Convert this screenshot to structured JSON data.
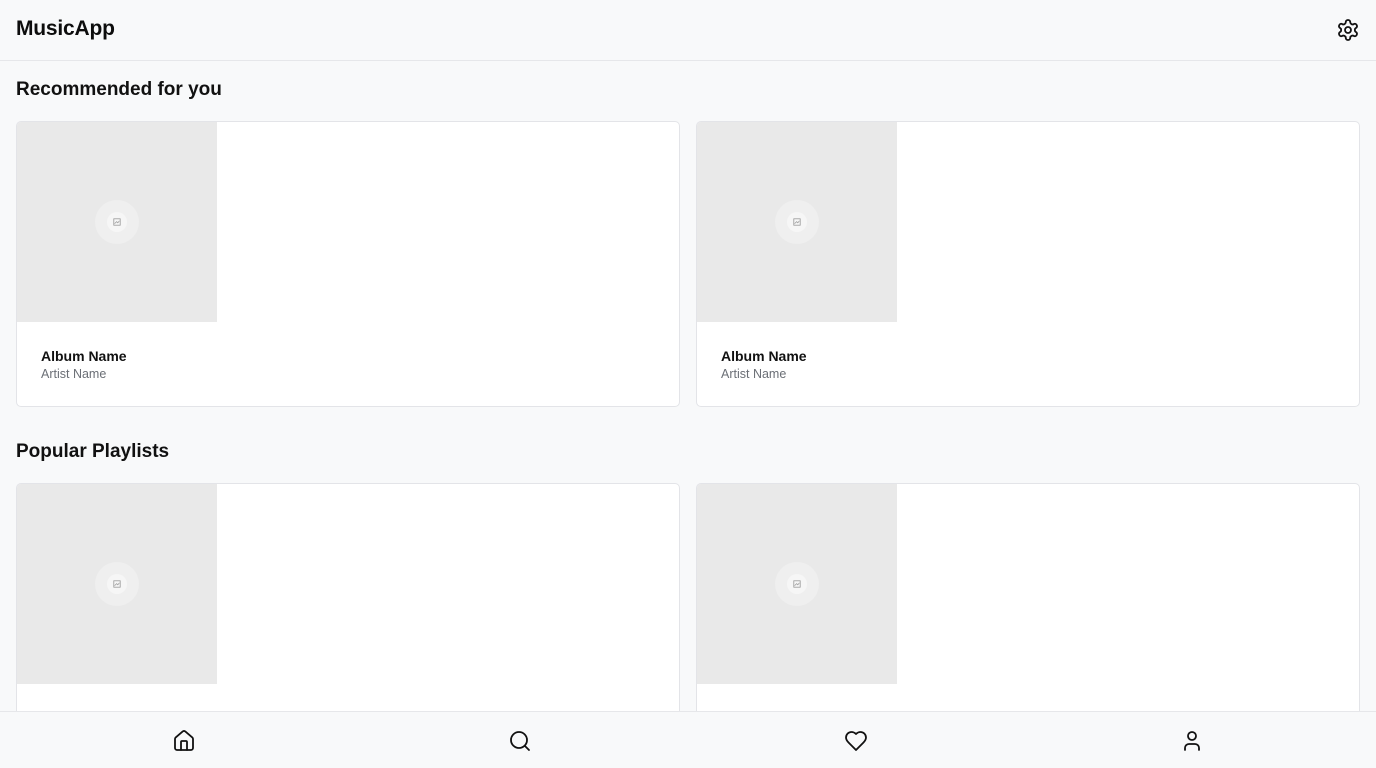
{
  "app": {
    "title": "MusicApp"
  },
  "header": {
    "settings_icon": "gear-icon"
  },
  "sections": [
    {
      "title": "Recommended for you",
      "cards": [
        {
          "name": "Album Name",
          "artist": "Artist Name",
          "art_icon": "image-placeholder-icon"
        },
        {
          "name": "Album Name",
          "artist": "Artist Name",
          "art_icon": "image-placeholder-icon"
        }
      ]
    },
    {
      "title": "Popular Playlists",
      "cards": [
        {
          "art_icon": "image-placeholder-icon"
        },
        {
          "art_icon": "image-placeholder-icon"
        }
      ]
    }
  ],
  "nav": {
    "items": [
      {
        "icon": "home-icon"
      },
      {
        "icon": "search-icon"
      },
      {
        "icon": "heart-icon"
      },
      {
        "icon": "user-icon"
      }
    ]
  },
  "colors": {
    "background": "#f8f9fa",
    "card": "#ffffff",
    "border": "#e3e4e8",
    "placeholder": "#e9e9e9",
    "text_primary": "#111111",
    "text_secondary": "#6b6f76"
  }
}
